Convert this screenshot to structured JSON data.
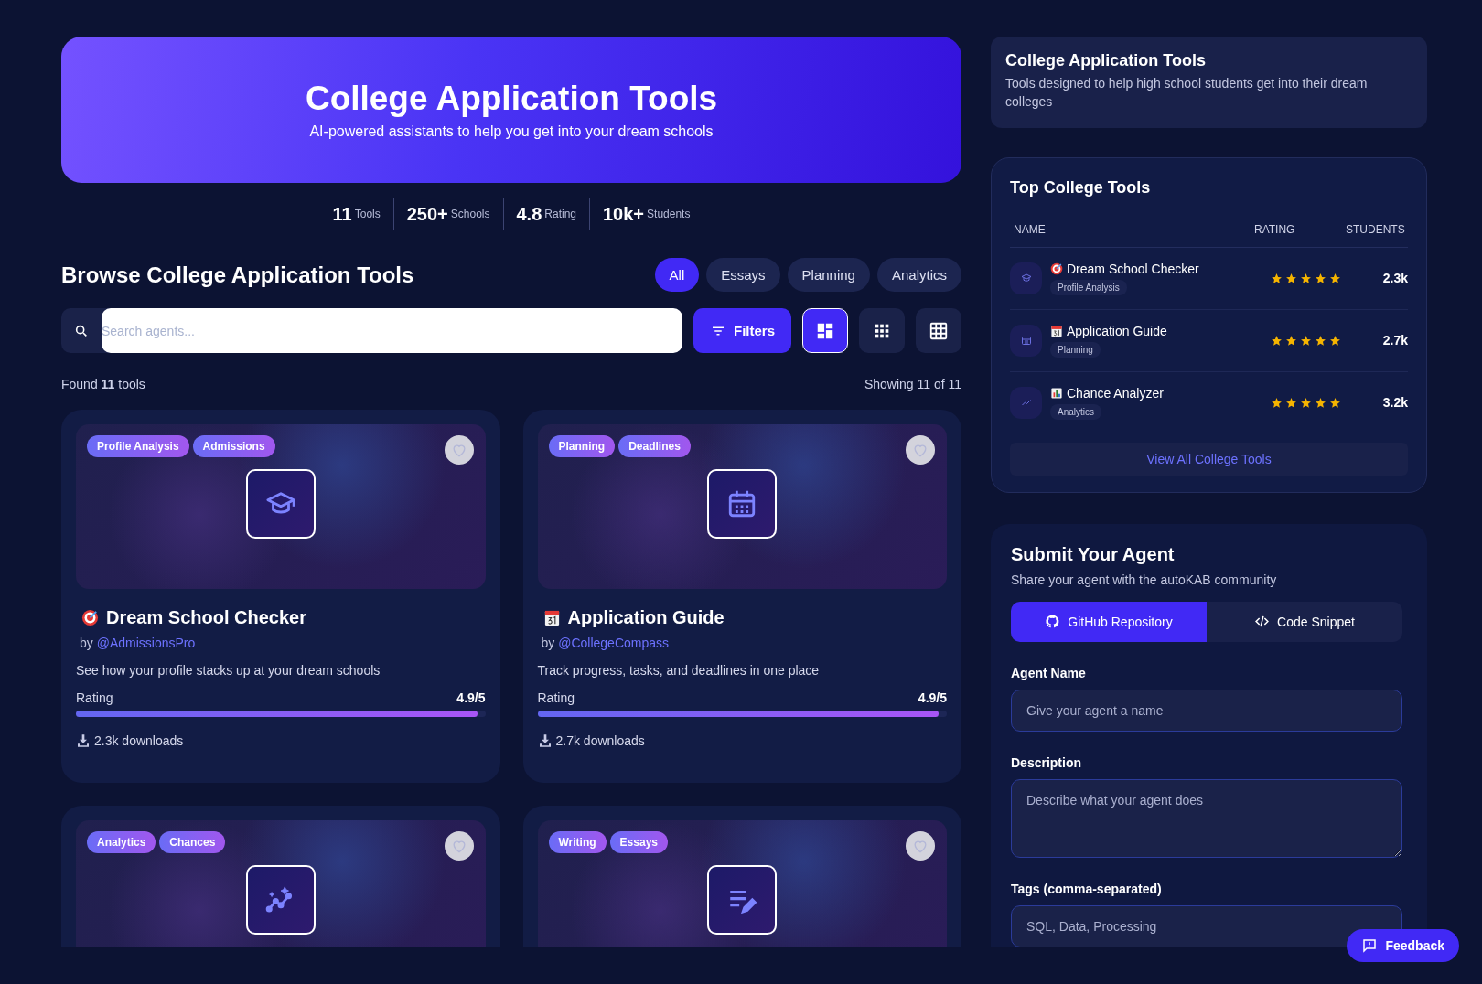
{
  "hero": {
    "title": "College Application Tools",
    "subtitle": "AI-powered assistants to help you get into your dream schools"
  },
  "stats": [
    {
      "value": "11",
      "label": "Tools"
    },
    {
      "value": "250+",
      "label": "Schools"
    },
    {
      "value": "4.8",
      "label": "Rating"
    },
    {
      "value": "10k+",
      "label": "Students"
    }
  ],
  "browse": {
    "title": "Browse College Application Tools",
    "filters": [
      {
        "label": "All",
        "selected": true
      },
      {
        "label": "Essays",
        "selected": false
      },
      {
        "label": "Planning",
        "selected": false
      },
      {
        "label": "Analytics",
        "selected": false
      }
    ],
    "search": {
      "placeholder": "Search agents..."
    },
    "filters_button": "Filters",
    "views": [
      {
        "kind": "dashboard",
        "selected": true
      },
      {
        "kind": "apps",
        "selected": false
      },
      {
        "kind": "table",
        "selected": false
      }
    ],
    "found": "Found **11** tools",
    "showing": "Showing 11 of 11"
  },
  "cards": [
    {
      "tags": [
        "Profile Analysis",
        "Admissions"
      ],
      "kind": "graduation",
      "name": "Dream School Checker",
      "by": "by",
      "author": "@AdmissionsPro",
      "description": "See how your profile stacks up at your dream schools",
      "rating_label": "Rating",
      "rating": "4.9/5",
      "level": 0.98,
      "downloads": "2.3k downloads",
      "favorite": false
    },
    {
      "tags": [
        "Planning",
        "Deadlines"
      ],
      "kind": "calendar",
      "name": "Application Guide",
      "by": "by",
      "author": "@CollegeCompass",
      "description": "Track progress, tasks, and deadlines in one place",
      "rating_label": "Rating",
      "rating": "4.9/5",
      "level": 0.98,
      "downloads": "2.7k downloads",
      "favorite": false
    },
    {
      "tags": [
        "Analytics",
        "Chances"
      ],
      "kind": "chart",
      "favorite": false
    },
    {
      "tags": [
        "Writing",
        "Essays"
      ],
      "kind": "edit",
      "favorite": false
    }
  ],
  "info": {
    "title": "College Application Tools",
    "description": "Tools designed to help high school students get into their dream colleges"
  },
  "top_tools": {
    "title": "Top College Tools",
    "columns": [
      "NAME",
      "RATING",
      "STUDENTS"
    ],
    "rows": [
      {
        "kind": "graduation",
        "name": "Dream School Checker",
        "tag": "Profile Analysis",
        "stars": 5,
        "students": "2.3k"
      },
      {
        "kind": "calendar",
        "name": "Application Guide",
        "tag": "Planning",
        "stars": 5,
        "students": "2.7k"
      },
      {
        "kind": "chart",
        "name": "Chance Analyzer",
        "tag": "Analytics",
        "stars": 5,
        "students": "3.2k"
      }
    ],
    "link": "View All College Tools"
  },
  "submit": {
    "title": "Submit Your Agent",
    "subtitle": "Share your agent with the autoKAB community",
    "tabs": [
      {
        "label": "GitHub Repository",
        "kind": "github",
        "selected": true
      },
      {
        "label": "Code Snippet",
        "kind": "code",
        "selected": false
      }
    ],
    "fields": [
      {
        "label": "Agent Name",
        "kind": "input",
        "placeholder": "Give your agent a name"
      },
      {
        "label": "Description",
        "kind": "textarea",
        "placeholder": "Describe what your agent does"
      },
      {
        "label": "Tags (comma-separated)",
        "kind": "input",
        "placeholder": "SQL, Data, Processing"
      }
    ]
  },
  "feedback_button": "Feedback"
}
